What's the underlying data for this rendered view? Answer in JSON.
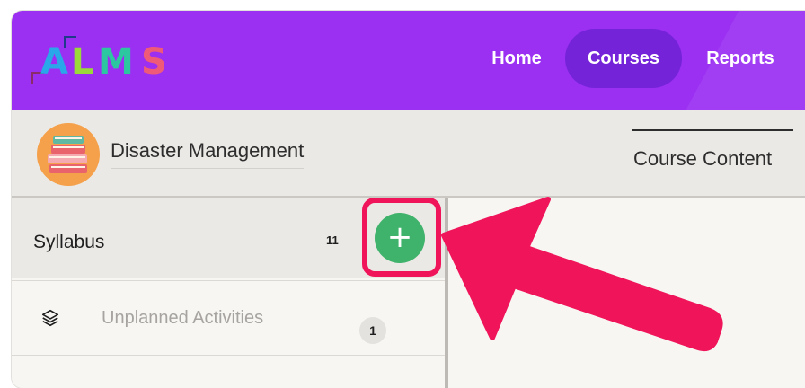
{
  "header": {
    "logo": {
      "letters": [
        "A",
        "L",
        "M",
        "S"
      ],
      "colors": [
        "#2aa7e8",
        "#9bd83a",
        "#2cc6a1",
        "#ef5a78"
      ]
    },
    "nav": [
      {
        "label": "Home",
        "active": false
      },
      {
        "label": "Courses",
        "active": true
      },
      {
        "label": "Reports",
        "active": false
      }
    ],
    "color": "#9b30f2",
    "active_color": "#7423d9"
  },
  "course": {
    "title": "Disaster Management",
    "tab": "Course Content"
  },
  "sidebar": {
    "syllabus": {
      "title": "Syllabus",
      "count": "11",
      "add_icon": "+"
    },
    "items": [
      {
        "label": "Unplanned Activities",
        "badge": "1",
        "icon": "layers-icon"
      }
    ]
  },
  "annotation": {
    "highlight_color": "#f0145a",
    "arrow_color": "#f0145a"
  }
}
